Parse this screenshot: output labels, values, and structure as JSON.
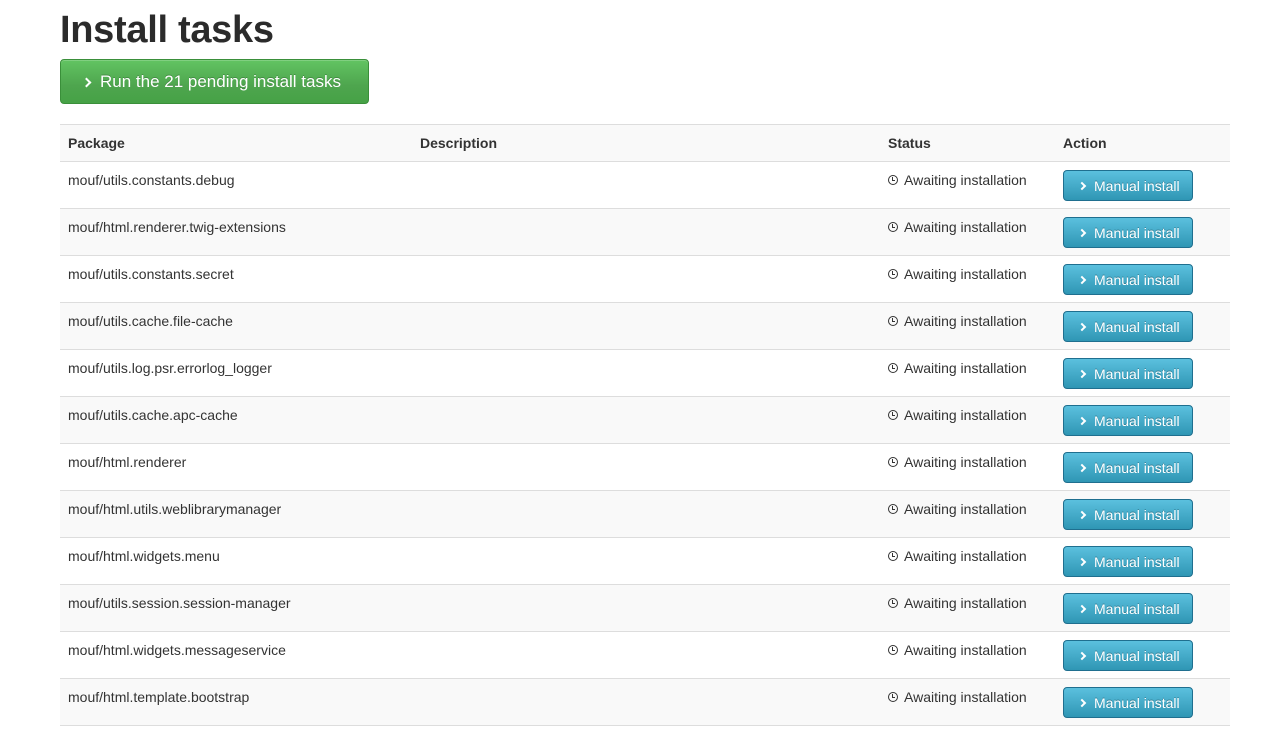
{
  "page": {
    "title": "Install tasks",
    "run_button_label": "Run the 21 pending install tasks"
  },
  "table": {
    "headers": {
      "package": "Package",
      "description": "Description",
      "status": "Status",
      "action": "Action"
    },
    "rows": [
      {
        "package": "mouf/utils.constants.debug",
        "description": "",
        "status": "Awaiting installation",
        "action": "Manual install"
      },
      {
        "package": "mouf/html.renderer.twig-extensions",
        "description": "",
        "status": "Awaiting installation",
        "action": "Manual install"
      },
      {
        "package": "mouf/utils.constants.secret",
        "description": "",
        "status": "Awaiting installation",
        "action": "Manual install"
      },
      {
        "package": "mouf/utils.cache.file-cache",
        "description": "",
        "status": "Awaiting installation",
        "action": "Manual install"
      },
      {
        "package": "mouf/utils.log.psr.errorlog_logger",
        "description": "",
        "status": "Awaiting installation",
        "action": "Manual install"
      },
      {
        "package": "mouf/utils.cache.apc-cache",
        "description": "",
        "status": "Awaiting installation",
        "action": "Manual install"
      },
      {
        "package": "mouf/html.renderer",
        "description": "",
        "status": "Awaiting installation",
        "action": "Manual install"
      },
      {
        "package": "mouf/html.utils.weblibrarymanager",
        "description": "",
        "status": "Awaiting installation",
        "action": "Manual install"
      },
      {
        "package": "mouf/html.widgets.menu",
        "description": "",
        "status": "Awaiting installation",
        "action": "Manual install"
      },
      {
        "package": "mouf/utils.session.session-manager",
        "description": "",
        "status": "Awaiting installation",
        "action": "Manual install"
      },
      {
        "package": "mouf/html.widgets.messageservice",
        "description": "",
        "status": "Awaiting installation",
        "action": "Manual install"
      },
      {
        "package": "mouf/html.template.bootstrap",
        "description": "",
        "status": "Awaiting installation",
        "action": "Manual install"
      }
    ]
  },
  "icons": {
    "run_button": "chevron-right-icon",
    "status": "clock-icon",
    "action_button": "chevron-right-icon"
  },
  "colors": {
    "run_button": "#5bb75b",
    "action_button": "#49afcd"
  }
}
